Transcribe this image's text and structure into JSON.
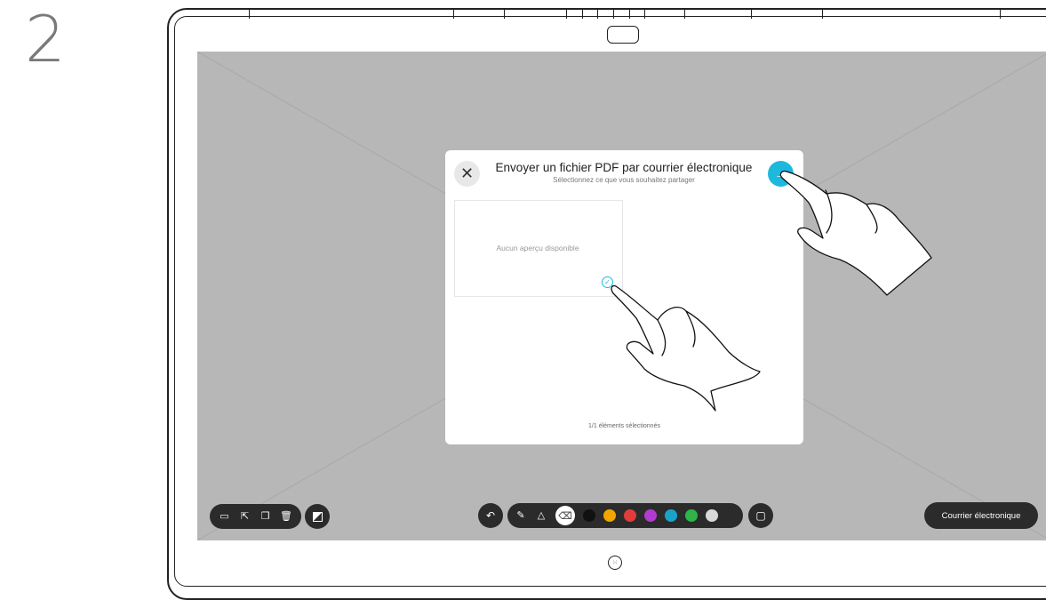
{
  "step_number": "2",
  "dialog": {
    "title": "Envoyer un fichier PDF par courrier électronique",
    "subtitle": "Sélectionnez ce que vous souhaitez partager",
    "close_icon": "close-icon",
    "send_icon": "arrow-right-icon",
    "accent_color": "#1fb8dd",
    "thumbnail_text": "Aucun aperçu disponible",
    "selection_status": "1/1 éléments sélectionnés"
  },
  "toolbar": {
    "left_icons": [
      "folder-open-icon",
      "export-icon",
      "copy-icon",
      "trash-icon"
    ],
    "edit_icon": "whiteboard-icon",
    "undo_icon": "undo-icon",
    "tools": [
      "pen-icon",
      "shapes-icon",
      "eraser-icon"
    ],
    "colors": [
      "#111111",
      "#f0a500",
      "#e03c3c",
      "#b13bd1",
      "#1aa3c9",
      "#2fb34a",
      "#d8d8d8"
    ],
    "sticky_icon": "sticky-note-icon",
    "email_label": "Courrier électronique"
  },
  "home_icon": "app-grid-icon"
}
